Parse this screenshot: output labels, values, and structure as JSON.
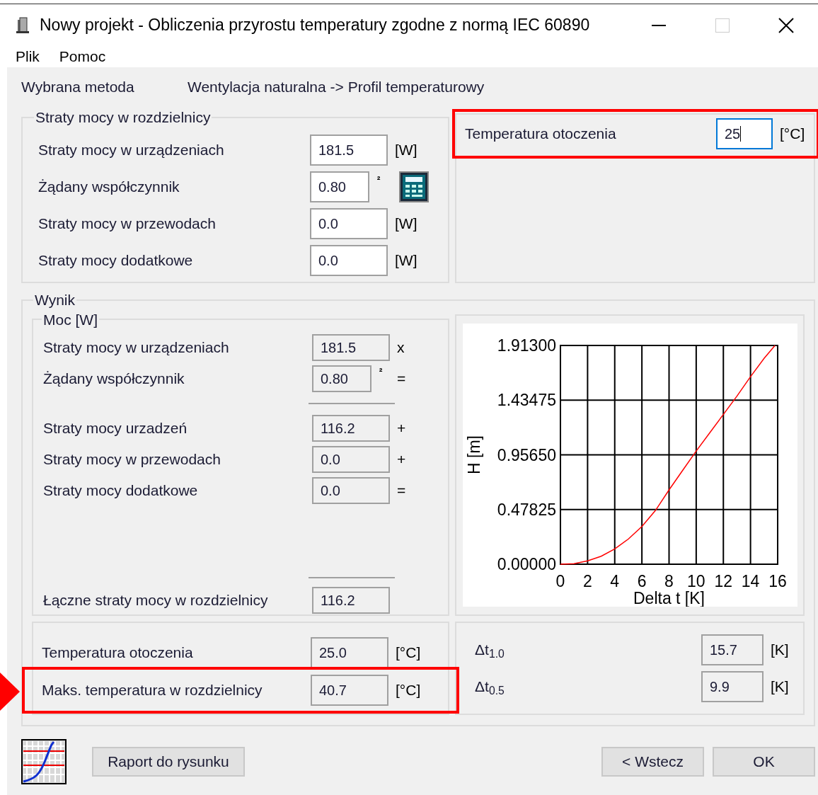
{
  "window": {
    "title": "Nowy projekt - Obliczenia przyrostu temperatury zgodne z normą IEC 60890"
  },
  "menu": [
    "Plik",
    "Pomoc"
  ],
  "method": {
    "label": "Wybrana metoda",
    "value": "Wentylacja naturalna -> Profil temperaturowy"
  },
  "losses_group": {
    "title": "Straty mocy w rozdzielnicy",
    "rows": [
      {
        "label": "Straty mocy w urządzeniach",
        "value": "181.5",
        "unit": "[W]"
      },
      {
        "label": "Żądany współczynnik",
        "value": "0.80",
        "exponent": "²"
      },
      {
        "label": "Straty mocy w przewodach",
        "value": "0.0",
        "unit": "[W]"
      },
      {
        "label": "Straty mocy dodatkowe",
        "value": "0.0",
        "unit": "[W]"
      }
    ]
  },
  "ambient": {
    "label": "Temperatura otoczenia",
    "value": "25",
    "unit": "[°C]",
    "focused": true,
    "highlighted": true
  },
  "result": {
    "title": "Wynik",
    "power": {
      "title": "Moc [W]",
      "product_rows": [
        {
          "label": "Straty mocy w urządzeniach",
          "value": "181.5",
          "operator": "x"
        },
        {
          "label": "Żądany współczynnik",
          "value": "0.80",
          "exponent": "²",
          "operator": "="
        }
      ],
      "sum_rows": [
        {
          "label": "Straty mocy urzadzeń",
          "value": "116.2",
          "operator": "+"
        },
        {
          "label": "Straty mocy w przewodach",
          "value": "0.0",
          "operator": "+"
        },
        {
          "label": "Straty mocy dodatkowe",
          "value": "0.0",
          "operator": "="
        }
      ],
      "total": {
        "label": "Łączne straty mocy w rozdzielnicy",
        "value": "116.2"
      }
    },
    "chart": {
      "chart_data": {
        "type": "line",
        "xlabel": "Delta t [K]",
        "ylabel": "H [m]",
        "x": [
          0,
          1,
          2,
          3,
          4,
          5,
          6,
          7,
          8,
          9,
          10,
          11,
          12,
          13,
          14,
          15,
          15.8
        ],
        "grid": true,
        "series": [
          {
            "color": "#ff0000",
            "values": [
              0,
              0.005,
              0.03,
              0.07,
              0.134,
              0.22,
              0.33,
              0.47,
              0.65,
              0.82,
              0.99,
              1.15,
              1.31,
              1.47,
              1.64,
              1.8,
              1.913
            ]
          }
        ],
        "xlim": [
          0,
          16
        ],
        "ylim": [
          0,
          1.913
        ],
        "xticks": [
          0,
          2,
          4,
          6,
          8,
          10,
          12,
          14,
          16
        ],
        "yticks": [
          {
            "value": 0,
            "label": "0.00000"
          },
          {
            "value": 0.47825,
            "label": "0.47825"
          },
          {
            "value": 0.9565,
            "label": "0.95650"
          },
          {
            "value": 1.43475,
            "label": "1.43475"
          },
          {
            "value": 1.913,
            "label": "1.91300"
          }
        ]
      }
    },
    "temperatures": [
      {
        "label": "Temperatura otoczenia",
        "value": "25.0",
        "unit": "[°C]",
        "highlighted": false
      },
      {
        "label": "Maks. temperatura w rozdzielnicy",
        "value": "40.7",
        "unit": "[°C]",
        "highlighted": true
      }
    ],
    "deltas": [
      {
        "label": "Δt$_{1.0}$",
        "value": "15.7",
        "unit": "[K]"
      },
      {
        "label": "Δt$_{0.5}$",
        "value": "9.9",
        "unit": "[K]"
      }
    ]
  },
  "buttons": {
    "report": "Raport do rysunku",
    "back": "< Wstecz",
    "ok": "OK"
  }
}
